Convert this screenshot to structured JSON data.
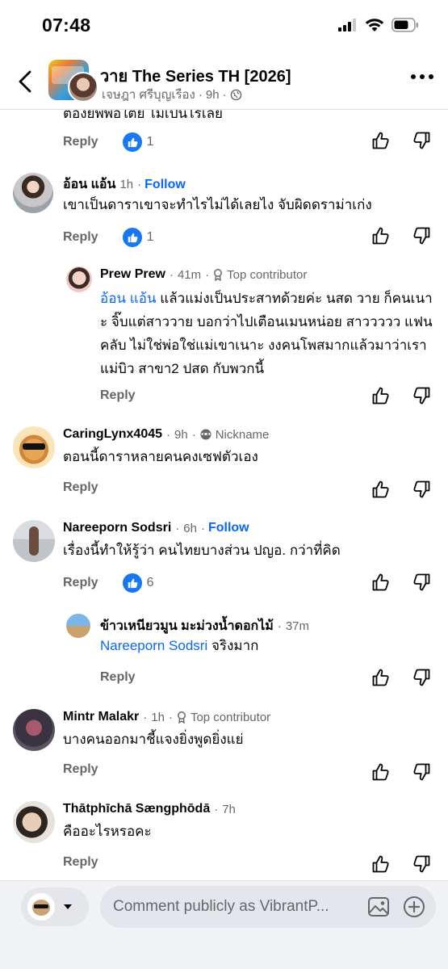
{
  "status_bar": {
    "time": "07:48"
  },
  "header": {
    "title": "วาย The Series TH [2026]",
    "author": "เจษฎา ศรีบุญเรือง",
    "time": "9h",
    "separator": "·"
  },
  "clipped_comment": {
    "text": "ต้องยิพพ่อใต้ย ไม่เป็นไรเลย",
    "reply_label": "Reply",
    "likes": "1"
  },
  "comments": [
    {
      "name": "อ้อน แอ้น",
      "time": "1h",
      "follow": "Follow",
      "text": "เขาเป็นดาราเขาจะทำไรไม่ได้เลยไง จับผิดดราม่าเก่ง",
      "reply_label": "Reply",
      "likes": "1"
    },
    {
      "name": "Prew Prew",
      "time": "41m",
      "badge": "Top contributor",
      "mention": "อ้อน แอ้น",
      "text": " แล้วแม่งเป็นประสาทด้วยค่ะ นสด วาย ก็คนเนาะ จิ๊บแต่สาววาย บอกว่าไปเตือนเมนหน่อย สาววววว แฟนคลับ ไม่ใช่พ่อใช่แม่เขาเนาะ งงคนโพสมากแล้วมาว่าเรา แม่บิว สาขา2 ปสด กับพวกนี้",
      "reply_label": "Reply"
    },
    {
      "name": "CaringLynx4045",
      "time": "9h",
      "badge": "Nickname",
      "text": "ตอนนี้ดาราหลายคนคงเซฟตัวเอง",
      "reply_label": "Reply"
    },
    {
      "name": "Nareeporn Sodsri",
      "time": "6h",
      "follow": "Follow",
      "text": "เรื่องนี้ทำให้รู้ว่า คนไทยบางส่วน ปญอ. กว่าที่คิด",
      "reply_label": "Reply",
      "likes": "6"
    },
    {
      "name": "ข้าวเหนียวมูน มะม่วงน้ำดอกไม้",
      "time": "37m",
      "mention": "Nareeporn Sodsri",
      "text": " จริงมาก",
      "reply_label": "Reply"
    },
    {
      "name": "Mintr Malakr",
      "time": "1h",
      "badge": "Top contributor",
      "text": "บางคนออกมาชี้แจงยิ่งพูดยิ่งแย่",
      "reply_label": "Reply"
    },
    {
      "name": "Thātphīchā Sængphōdā",
      "time": "7h",
      "text": "คืออะไรหรอคะ",
      "reply_label": "Reply"
    }
  ],
  "composer": {
    "placeholder": "Comment publicly as VibrantP..."
  },
  "colors": {
    "link_blue": "#0866ff",
    "like_blue": "#1877f2",
    "secondary_text": "#65676b"
  }
}
